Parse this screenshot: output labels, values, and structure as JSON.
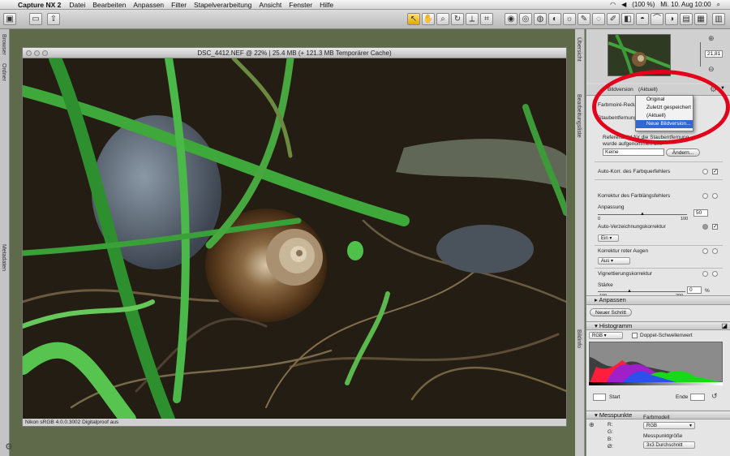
{
  "menubar": {
    "app_name": "Capture NX 2",
    "items": [
      "Datei",
      "Bearbeiten",
      "Anpassen",
      "Filter",
      "Stapelverarbeitung",
      "Ansicht",
      "Fenster",
      "Hilfe"
    ],
    "battery": "(100 %)",
    "clock": "Mi. 10. Aug  10:00"
  },
  "left_strip": {
    "browser": "Browser",
    "ordner": "Ordner",
    "metadaten": "Metadaten"
  },
  "image_window": {
    "title": "DSC_4412.NEF @ 22% | 25.4 MB (+ 121.3 MB Temporärer Cache)",
    "status": "Nikon sRGB 4.0.0.3002 Digitalproof aus"
  },
  "right_strip": {
    "ubersicht": "Übersicht",
    "bearbeitungsliste": "Bearbeitungsliste",
    "bildinfo": "Bildinfo"
  },
  "overview": {
    "zoom_value": "21,81"
  },
  "edit_list": {
    "bildversion_label": "Bildversion",
    "bildversion_value": "(Aktuell)",
    "farbmoire": "Farbmoiré-Redu",
    "staubentfernung": "Staubentfernung",
    "ref_text_1": "Referenzbild für die Staubentfernung",
    "ref_text_2": "wurde aufgenommen um:",
    "keine_value": "Keine",
    "andern_button": "Ändern...",
    "auto_korr": "Auto-Korr. des Farbquerfehlers",
    "farblangsfehler": "Korrektur des Farblängsfehlers",
    "anpassung": "Anpassung",
    "anpassung_min": "0",
    "anpassung_max": "100",
    "anpassung_value": "50",
    "auto_verz": "Auto-Verzeichnungskorrektur",
    "ein_value": "Ein",
    "rote_augen": "Korrektur roter Augen",
    "aus_value": "Aus",
    "vignettierung": "Vignettierungskorrektur",
    "starke": "Stärke",
    "starke_min": "-100",
    "starke_max": "200",
    "starke_value": "0",
    "percent": "%",
    "anpassen_header": "Anpassen",
    "neuer_schritt": "Neuer Schritt"
  },
  "dropdown": {
    "options": [
      "Original",
      "Zuletzt gespeichert",
      "(Aktuell)",
      "Neue Bildversion..."
    ],
    "highlighted": "Neue Bildversion..."
  },
  "histogram": {
    "header": "Histogramm",
    "channel": "RGB",
    "doppel": "Doppel-Schwellenwert",
    "start_label": "Start",
    "ende_label": "Ende"
  },
  "messpunkte": {
    "header": "Messpunkte",
    "r": "R:",
    "g": "G:",
    "b": "B:",
    "o": "Ø:",
    "farbmodell_label": "Farbmodell",
    "farbmodell_value": "RGB",
    "grosse_label": "Messpunktgröße",
    "grosse_value": "3x3 Durchschnitt"
  },
  "colors": {
    "highlight": "#3465d4",
    "ring": "#e3001b"
  }
}
